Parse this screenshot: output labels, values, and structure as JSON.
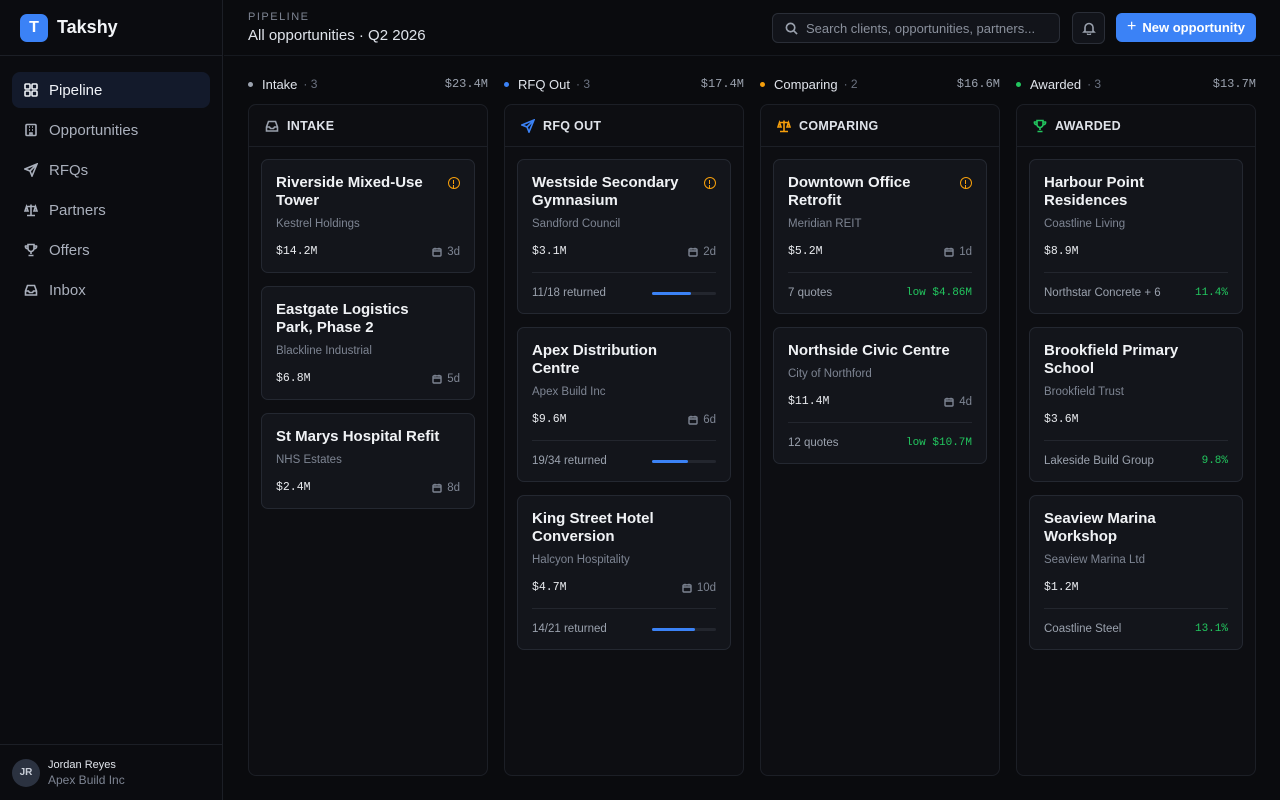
{
  "app": {
    "logo_letter": "T",
    "name": "Takshy"
  },
  "sidebar": {
    "items": [
      {
        "label": "Pipeline",
        "icon": "grid-icon",
        "active": true
      },
      {
        "label": "Opportunities",
        "icon": "building-icon"
      },
      {
        "label": "RFQs",
        "icon": "send-icon"
      },
      {
        "label": "Partners",
        "icon": "scale-icon"
      },
      {
        "label": "Offers",
        "icon": "trophy-icon"
      },
      {
        "label": "Inbox",
        "icon": "inbox-icon"
      }
    ],
    "user": {
      "initials": "JR",
      "name": "Jordan Reyes",
      "org": "Apex Build Inc"
    }
  },
  "header": {
    "eyebrow": "PIPELINE",
    "title": "All opportunities · Q2 2026",
    "search_placeholder": "Search clients, opportunities, partners...",
    "new_button": "New opportunity"
  },
  "colors": {
    "accent": "#3b82f6",
    "intake": "#9ca3af",
    "rfq": "#3b82f6",
    "comparing": "#f59e0b",
    "awarded": "#22c55e"
  },
  "columns": [
    {
      "summary": {
        "name": "Intake",
        "count": "· 3",
        "total": "$23.4M"
      },
      "title": "INTAKE",
      "cards": [
        {
          "title": "Riverside Mixed-Use Tower",
          "client": "Kestrel Holdings",
          "value": "$14.2M",
          "age": "3d"
        },
        {
          "title": "Eastgate Logistics Park, Phase 2",
          "client": "Blackline Industrial",
          "value": "$6.8M",
          "age": "5d"
        },
        {
          "title": "St Marys Hospital Refit",
          "client": "NHS Estates",
          "value": "$2.4M",
          "age": "8d"
        }
      ]
    },
    {
      "summary": {
        "name": "RFQ Out",
        "count": "· 3",
        "total": "$17.4M"
      },
      "title": "RFQ OUT",
      "cards": [
        {
          "title": "Westside Secondary Gymnasium",
          "client": "Sandford Council",
          "value": "$3.1M",
          "age": "2d",
          "returned": "11/18 returned",
          "progress": 0.61
        },
        {
          "title": "Apex Distribution Centre",
          "client": "Apex Build Inc",
          "value": "$9.6M",
          "age": "6d",
          "returned": "19/34 returned",
          "progress": 0.56
        },
        {
          "title": "King Street Hotel Conversion",
          "client": "Halcyon Hospitality",
          "value": "$4.7M",
          "age": "10d",
          "returned": "14/21 returned",
          "progress": 0.67
        }
      ]
    },
    {
      "summary": {
        "name": "Comparing",
        "count": "· 2",
        "total": "$16.6M"
      },
      "title": "COMPARING",
      "cards": [
        {
          "title": "Downtown Office Retrofit",
          "client": "Meridian REIT",
          "value": "$5.2M",
          "age": "1d",
          "quotes": "7 quotes",
          "low": "low $4.86M"
        },
        {
          "title": "Northside Civic Centre",
          "client": "City of Northford",
          "value": "$11.4M",
          "age": "4d",
          "quotes": "12 quotes",
          "low": "low $10.7M"
        }
      ]
    },
    {
      "summary": {
        "name": "Awarded",
        "count": "· 3",
        "total": "$13.7M"
      },
      "title": "AWARDED",
      "cards": [
        {
          "title": "Harbour Point Residences",
          "client": "Coastline Living",
          "value": "$8.9M",
          "partner": "Northstar Concrete + 6",
          "margin": "11.4%"
        },
        {
          "title": "Brookfield Primary School",
          "client": "Brookfield Trust",
          "value": "$3.6M",
          "partner": "Lakeside Build Group",
          "margin": "9.8%"
        },
        {
          "title": "Seaview Marina Workshop",
          "client": "Seaview Marina Ltd",
          "value": "$1.2M",
          "partner": "Coastline Steel",
          "margin": "13.1%"
        }
      ]
    }
  ]
}
